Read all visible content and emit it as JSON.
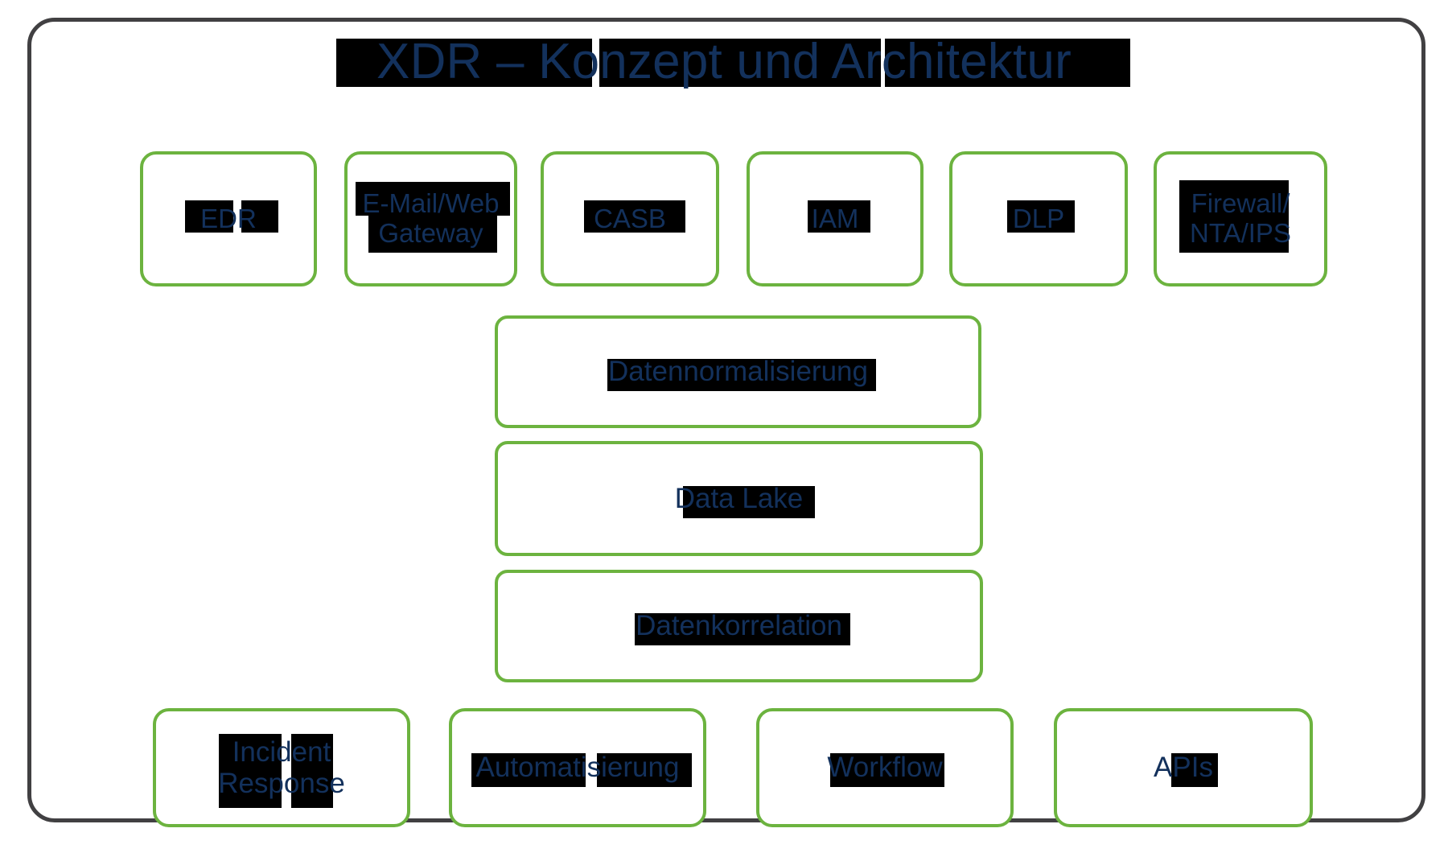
{
  "title": "XDR – Konzept und Architektur",
  "colors": {
    "frame_border": "#414042",
    "node_border": "#6cb33f",
    "text": "#13315c",
    "redaction": "#000000",
    "background": "#ffffff"
  },
  "sources_row": {
    "items": [
      {
        "label": "EDR"
      },
      {
        "label": "E-Mail/Web\nGateway"
      },
      {
        "label": "CASB"
      },
      {
        "label": "IAM"
      },
      {
        "label": "DLP"
      },
      {
        "label": "Firewall/\nNTA/IPS"
      }
    ]
  },
  "pipeline_stack": {
    "items": [
      {
        "label": "Datennormalisierung"
      },
      {
        "label": "Data Lake"
      },
      {
        "label": "Datenkorrelation"
      }
    ]
  },
  "actions_row": {
    "items": [
      {
        "label": "Incident\nResponse"
      },
      {
        "label": "Automatisierung"
      },
      {
        "label": "Workflow"
      },
      {
        "label": "APIs"
      }
    ]
  }
}
